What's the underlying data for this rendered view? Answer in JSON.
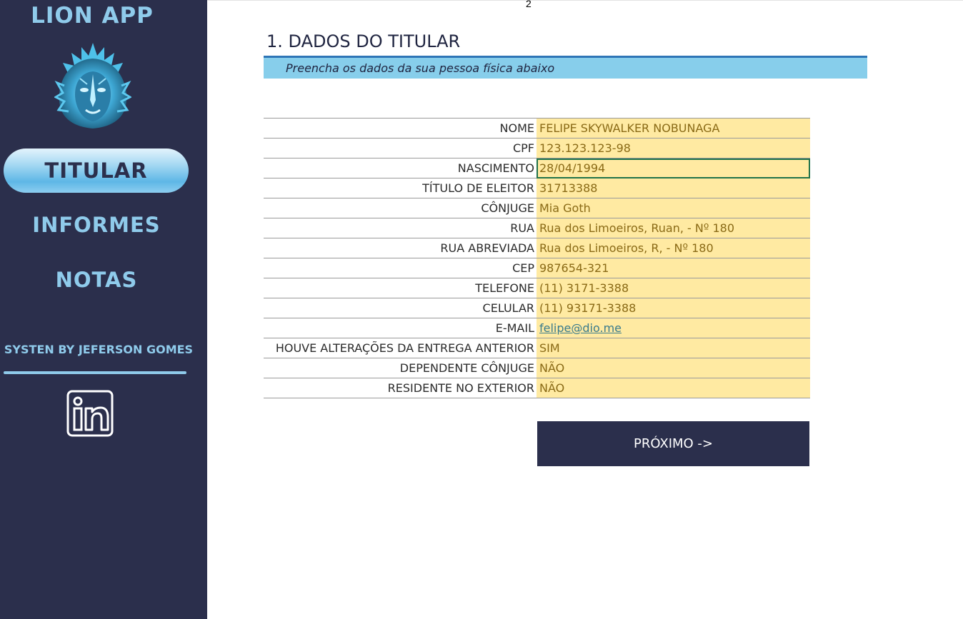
{
  "sidebar": {
    "app_title": "LION APP",
    "logo_icon": "lion-head-logo-icon",
    "nav": {
      "titular": "TITULAR",
      "informes": "INFORMES",
      "notas": "NOTAS"
    },
    "credit": "SYSTEN BY JEFERSON GOMES",
    "linkedin_icon": "linkedin-icon"
  },
  "page_number": "2",
  "section": {
    "title": "1. DADOS DO TITULAR",
    "subtitle": "Preencha os dados da sua pessoa física abaixo"
  },
  "form": {
    "rows": [
      {
        "label": "NOME",
        "value": "FELIPE SKYWALKER NOBUNAGA"
      },
      {
        "label": "CPF",
        "value": "123.123.123-98"
      },
      {
        "label": "NASCIMENTO",
        "value": "28/04/1994"
      },
      {
        "label": "TÍTULO DE ELEITOR",
        "value": "31713388"
      },
      {
        "label": "CÔNJUGE",
        "value": "Mia Goth"
      },
      {
        "label": "RUA",
        "value": "Rua dos Limoeiros, Ruan, - Nº 180"
      },
      {
        "label": "RUA ABREVIADA",
        "value": "Rua dos Limoeiros, R, - Nº 180"
      },
      {
        "label": "CEP",
        "value": "987654-321"
      },
      {
        "label": "TELEFONE",
        "value": "(11) 3171-3388"
      },
      {
        "label": "CELULAR",
        "value": "(11) 93171-3388"
      },
      {
        "label": "E-MAIL",
        "value": "felipe@dio.me"
      },
      {
        "label": "HOUVE ALTERAÇÕES DA ENTREGA ANTERIOR",
        "value": "SIM"
      },
      {
        "label": "DEPENDENTE CÔNJUGE",
        "value": "NÃO"
      },
      {
        "label": "RESIDENTE NO EXTERIOR",
        "value": "NÃO"
      }
    ]
  },
  "next_button": "PRÓXIMO ->",
  "colors": {
    "sidebar_bg": "#2b2f4c",
    "accent": "#8fcbeb",
    "subtitle_bar": "#87ceeb",
    "input_fill": "#ffeaa2",
    "selection": "#21734a"
  }
}
